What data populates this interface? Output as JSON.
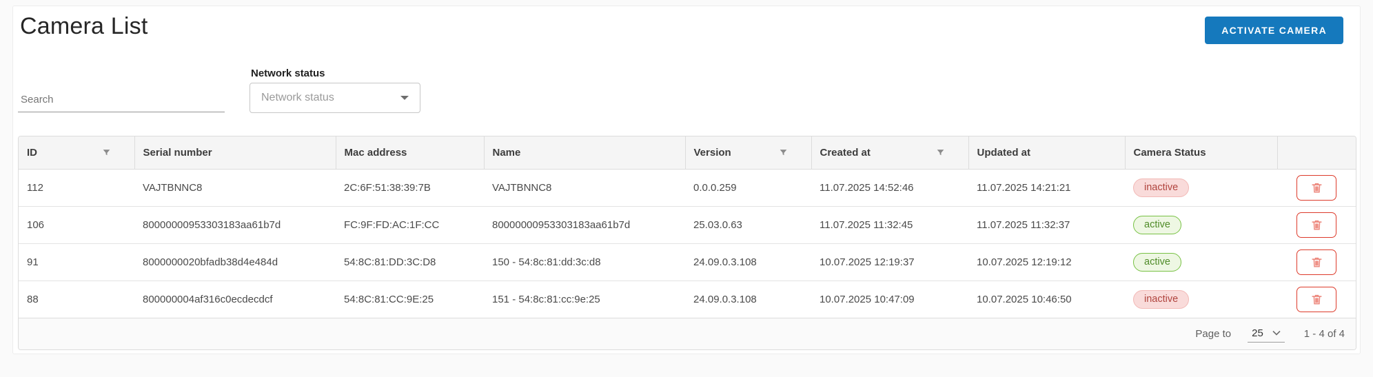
{
  "header": {
    "title": "Camera List",
    "activate_button_label": "ACTIVATE CAMERA"
  },
  "filters": {
    "search_placeholder": "Search",
    "network_status": {
      "label": "Network status",
      "placeholder": "Network status"
    }
  },
  "table": {
    "columns": [
      {
        "label": "ID",
        "has_filter": true
      },
      {
        "label": "Serial number",
        "has_filter": false
      },
      {
        "label": "Mac address",
        "has_filter": false
      },
      {
        "label": "Name",
        "has_filter": false
      },
      {
        "label": "Version",
        "has_filter": true
      },
      {
        "label": "Created at",
        "has_filter": true
      },
      {
        "label": "Updated at",
        "has_filter": false
      },
      {
        "label": "Camera Status",
        "has_filter": false
      },
      {
        "label": "",
        "has_filter": false
      }
    ],
    "rows": [
      {
        "id": "112",
        "serial": "VAJTBNNC8",
        "mac": "2C:6F:51:38:39:7B",
        "name": "VAJTBNNC8",
        "version": "0.0.0.259",
        "created_at": "11.07.2025 14:52:46",
        "updated_at": "11.07.2025 14:21:21",
        "status": "inactive"
      },
      {
        "id": "106",
        "serial": "80000000953303183aa61b7d",
        "mac": "FC:9F:FD:AC:1F:CC",
        "name": "80000000953303183aa61b7d",
        "version": "25.03.0.63",
        "created_at": "11.07.2025 11:32:45",
        "updated_at": "11.07.2025 11:32:37",
        "status": "active"
      },
      {
        "id": "91",
        "serial": "8000000020bfadb38d4e484d",
        "mac": "54:8C:81:DD:3C:D8",
        "name": "150 - 54:8c:81:dd:3c:d8",
        "version": "24.09.0.3.108",
        "created_at": "10.07.2025 12:19:37",
        "updated_at": "10.07.2025 12:19:12",
        "status": "active"
      },
      {
        "id": "88",
        "serial": "800000004af316c0ecdecdcf",
        "mac": "54:8C:81:CC:9E:25",
        "name": "151 - 54:8c:81:cc:9e:25",
        "version": "24.09.0.3.108",
        "created_at": "10.07.2025 10:47:09",
        "updated_at": "10.07.2025 10:46:50",
        "status": "inactive"
      }
    ]
  },
  "pagination": {
    "page_to_label": "Page to",
    "page_size": "25",
    "range": "1 - 4 of 4"
  },
  "colors": {
    "accent_blue": "#1579bd",
    "active_bg": "#eef7e3",
    "active_border": "#77c143",
    "active_text": "#4f8b28",
    "inactive_bg": "#f9dbda",
    "inactive_border": "#f2b8b5",
    "inactive_text": "#b0443e",
    "delete_border_red": "#dd3a2a",
    "delete_icon_red": "#ec8378",
    "header_bg": "#f5f5f5"
  },
  "icons": {
    "filter": "filter-funnel-icon",
    "network_dropdown": "caret-down-icon",
    "page_size_dropdown": "chevron-down-icon",
    "delete": "trash-icon"
  }
}
